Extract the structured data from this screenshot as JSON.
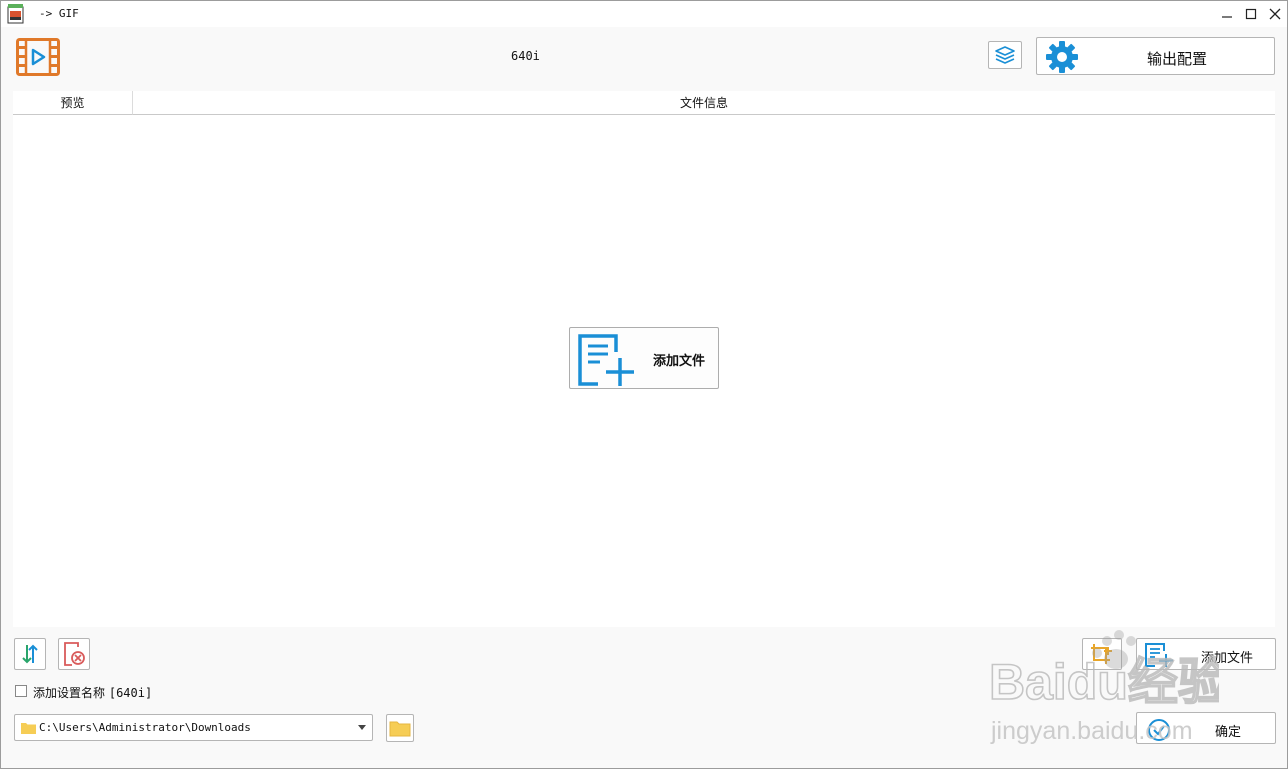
{
  "window": {
    "title": "-> GIF"
  },
  "header": {
    "profile_name": "640i",
    "output_config_label": "输出配置"
  },
  "list": {
    "columns": [
      "预览",
      "文件信息"
    ],
    "center_add_label": "添加文件"
  },
  "bottom": {
    "add_setting_name_label": "添加设置名称",
    "add_setting_name_value": "[640i]",
    "add_setting_name_checked": false,
    "output_path": "C:\\Users\\Administrator\\Downloads",
    "add_file_label": "添加文件",
    "ok_label": "确定"
  },
  "watermark": {
    "brand": "Baidu经验",
    "url": "jingyan.baidu.com"
  },
  "colors": {
    "accent_blue": "#1a8fd6",
    "logo_orange": "#e0792a",
    "folder_yellow": "#f6cd55",
    "remove_red": "#d95b5b",
    "sort_green": "#2aa56b"
  }
}
